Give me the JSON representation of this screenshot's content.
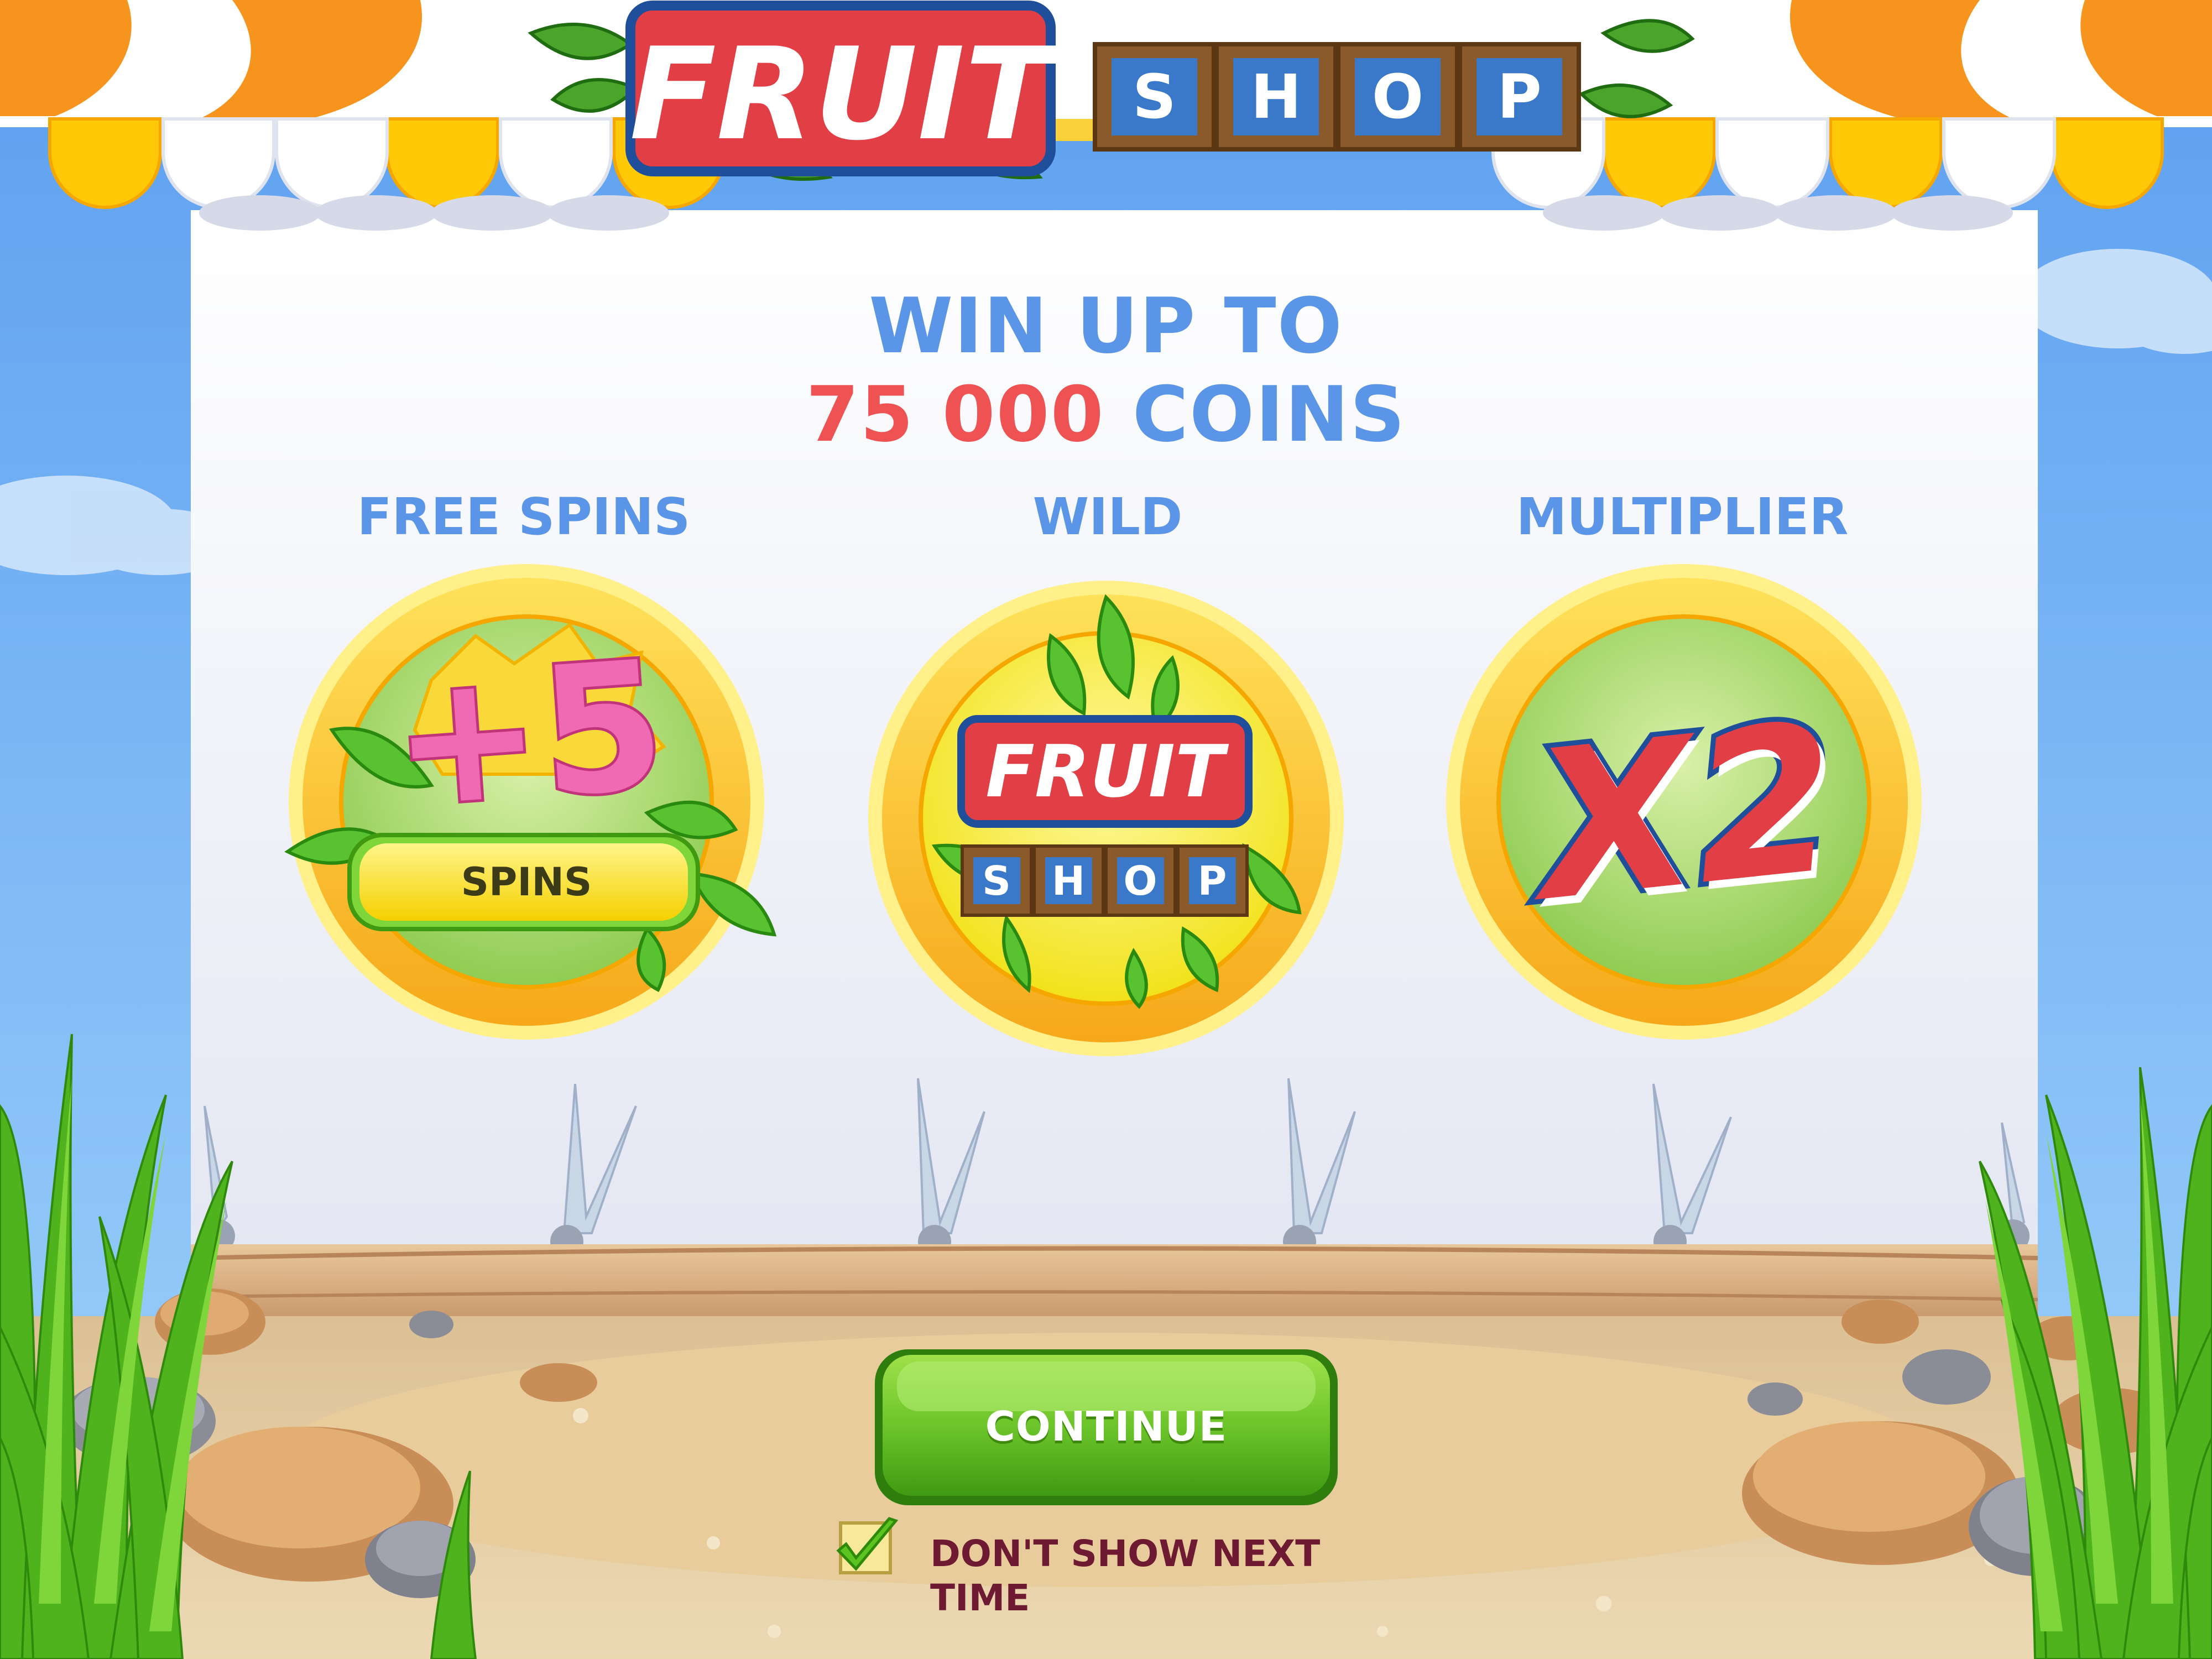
{
  "brand": {
    "logo_word1": "FRUIT",
    "logo_word2_letters": [
      "S",
      "H",
      "O",
      "P"
    ],
    "trademark": "™"
  },
  "headline": {
    "line1": "WIN UP TO",
    "amount": "75 000",
    "unit": "COINS"
  },
  "features": [
    {
      "title": "FREE SPINS",
      "badge_value": "+5",
      "badge_label": "SPINS",
      "icon": "free-spins-icon"
    },
    {
      "title": "WILD",
      "icon": "fruit-shop-wild-icon"
    },
    {
      "title": "MULTIPLIER",
      "badge_value": "X2",
      "icon": "multiplier-icon"
    }
  ],
  "continue_button": {
    "label": "CONTINUE"
  },
  "dont_show": {
    "label": "DON'T SHOW NEXT TIME",
    "checked": true
  },
  "colors": {
    "sky": "#7fbff5",
    "panel": "#eef0f8",
    "headline_blue": "#5b95e8",
    "headline_red": "#ef5252",
    "button_green": "#6cc52a",
    "awning_orange": "#f7941d",
    "awning_yellow": "#ffc907",
    "label_maroon": "#6e1a32"
  }
}
